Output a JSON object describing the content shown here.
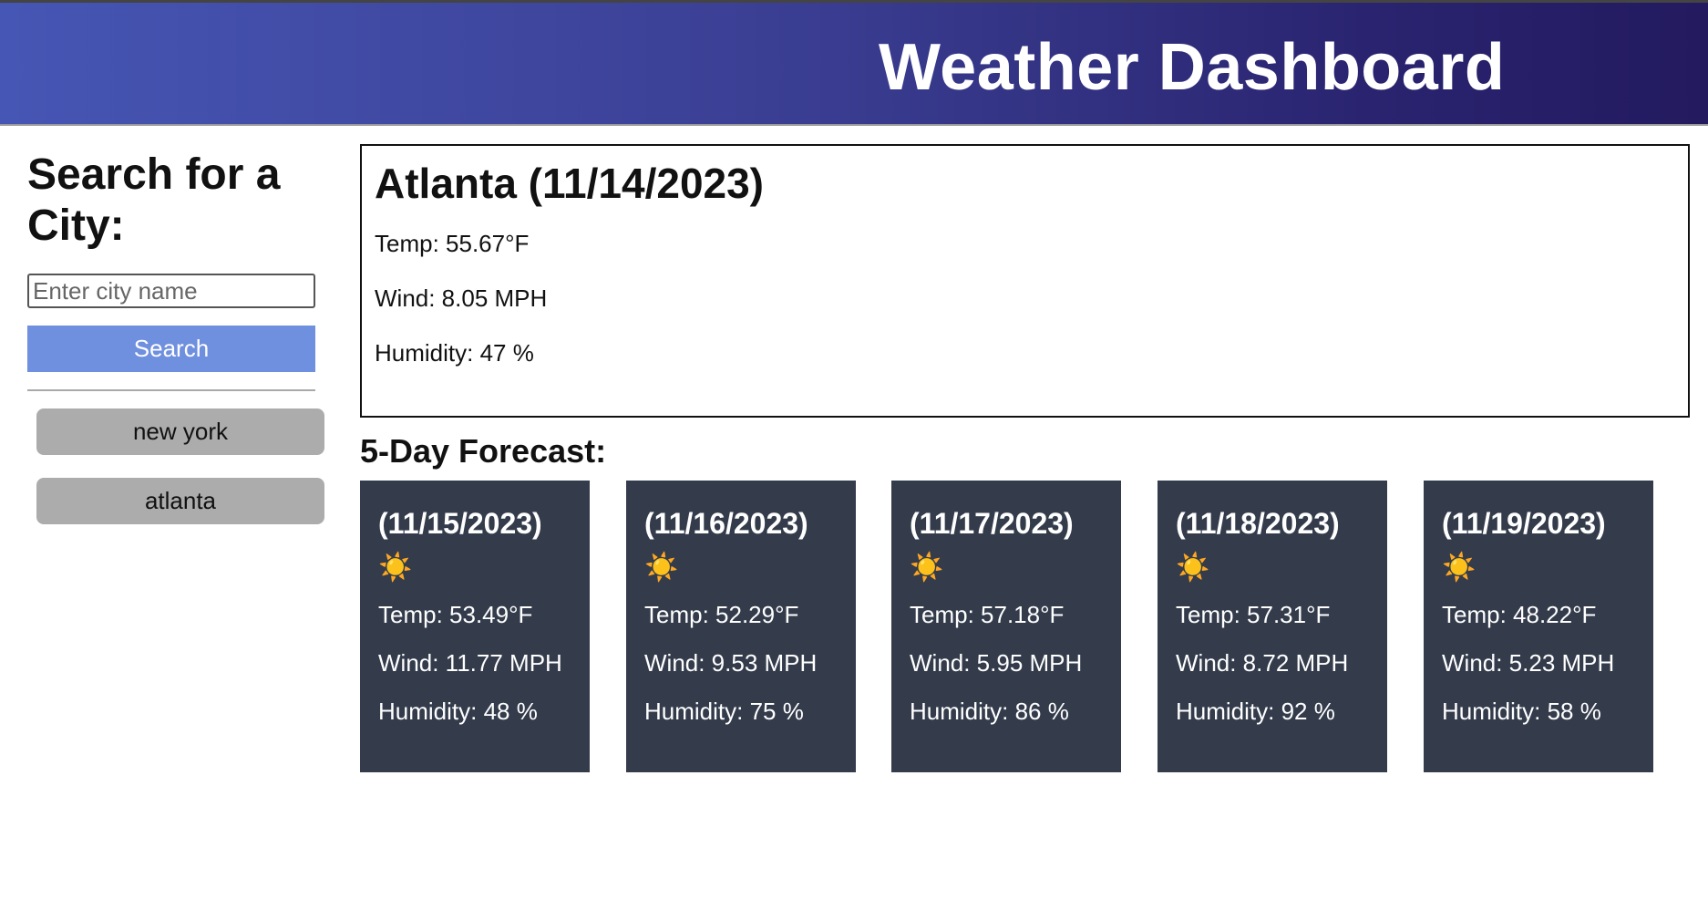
{
  "header": {
    "title": "Weather Dashboard"
  },
  "sidebar": {
    "heading": "Search for a City:",
    "search_placeholder": "Enter city name",
    "search_label": "Search",
    "history": [
      "new york",
      "atlanta"
    ]
  },
  "current": {
    "title": "Atlanta (11/14/2023)",
    "temp": "Temp: 55.67°F",
    "wind": "Wind: 8.05 MPH",
    "humidity": "Humidity: 47 %"
  },
  "forecast": {
    "title": "5-Day Forecast:",
    "days": [
      {
        "date": "(11/15/2023)",
        "icon": "sun-icon",
        "glyph": "☀️",
        "temp": "Temp: 53.49°F",
        "wind": "Wind: 11.77 MPH",
        "humidity": "Humidity: 48 %"
      },
      {
        "date": "(11/16/2023)",
        "icon": "sun-icon",
        "glyph": "☀️",
        "temp": "Temp: 52.29°F",
        "wind": "Wind: 9.53 MPH",
        "humidity": "Humidity: 75 %"
      },
      {
        "date": "(11/17/2023)",
        "icon": "sun-icon",
        "glyph": "☀️",
        "temp": "Temp: 57.18°F",
        "wind": "Wind: 5.95 MPH",
        "humidity": "Humidity: 86 %"
      },
      {
        "date": "(11/18/2023)",
        "icon": "sun-icon",
        "glyph": "☀️",
        "temp": "Temp: 57.31°F",
        "wind": "Wind: 8.72 MPH",
        "humidity": "Humidity: 92 %"
      },
      {
        "date": "(11/19/2023)",
        "icon": "sun-icon",
        "glyph": "☀️",
        "temp": "Temp: 48.22°F",
        "wind": "Wind: 5.23 MPH",
        "humidity": "Humidity: 58 %"
      }
    ]
  },
  "colors": {
    "header_gradient_start": "#4656b4",
    "header_gradient_end": "#231a5f",
    "search_button": "#6f8fdf",
    "history_button": "#acacac",
    "forecast_card": "#343c4c"
  }
}
